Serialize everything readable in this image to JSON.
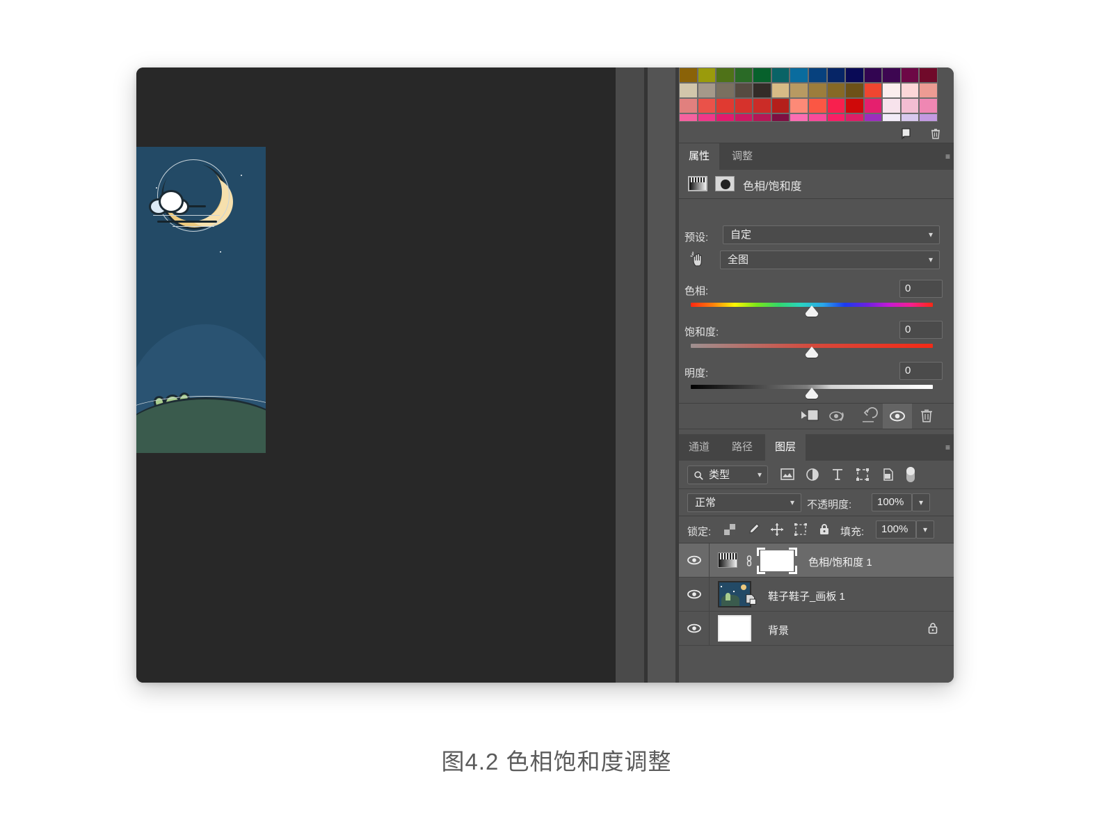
{
  "caption": "图4.2  色相饱和度调整",
  "swatches": {
    "rows": [
      [
        "#8a6208",
        "#9a9b0c",
        "#4f7218",
        "#2a6a26",
        "#07612c",
        "#0a6366",
        "#0a6c9e",
        "#07417e",
        "#062566",
        "#090a56",
        "#320551",
        "#3d0651",
        "#6d0846",
        "#700a2a"
      ],
      [
        "#d2c6ab",
        "#a5998a",
        "#7a7060",
        "#564b41",
        "#332c28",
        "#d7bb86",
        "#b89a62",
        "#9c7d3c",
        "#866926",
        "#6d5117",
        "#f04630",
        "#fbeeee",
        "#fcd6d8",
        "#ec9b93"
      ],
      [
        "#e1807e",
        "#ea5249",
        "#e03a31",
        "#d6322c",
        "#cb2c27",
        "#b41f1a",
        "#fd8a77",
        "#fb5744",
        "#f8204e",
        "#cf0909",
        "#e51f6e",
        "#f7e3ec",
        "#f3bdd2",
        "#ef87b3"
      ],
      [
        "#f5629f",
        "#f03889",
        "#e31a6d",
        "#cd1862",
        "#b51756",
        "#7d0f42",
        "#fb6eb2",
        "#f94b9a",
        "#f91f66",
        "#dd1f66",
        "#9b2fbd",
        "#f2ecf8",
        "#d8c9ee",
        "#c39ae2"
      ]
    ],
    "footer_icons": [
      "new-swatch-icon",
      "delete-swatch-icon"
    ]
  },
  "properties_panel": {
    "tabs": [
      {
        "label": "属性",
        "active": true
      },
      {
        "label": "调整",
        "active": false
      }
    ],
    "menu_glyph": "≡",
    "adjustment_title": "色相/饱和度",
    "preset_label": "预设:",
    "preset_value": "自定",
    "range_value": "全图",
    "sliders": [
      {
        "label": "色相:",
        "value": "0",
        "type": "hue",
        "thumb_pct": 50
      },
      {
        "label": "饱和度:",
        "value": "0",
        "type": "saturation",
        "thumb_pct": 50
      },
      {
        "label": "明度:",
        "value": "0",
        "type": "lightness",
        "thumb_pct": 50
      }
    ],
    "footer_icons": [
      "clip-to-layer-icon",
      "toggle-previous-state-icon",
      "reset-icon",
      "visibility-eye-icon",
      "delete-adjustment-icon"
    ]
  },
  "layers_panel": {
    "tabs": [
      {
        "label": "通道",
        "active": false
      },
      {
        "label": "路径",
        "active": false
      },
      {
        "label": "图层",
        "active": true
      }
    ],
    "menu_glyph": "≡",
    "filter_label": "类型",
    "filter_icons": [
      "pixel-layer-filter-icon",
      "adjustment-layer-filter-icon",
      "type-layer-filter-icon",
      "shape-layer-filter-icon",
      "smart-object-filter-icon",
      "filter-toggle-switch"
    ],
    "blend_mode": "正常",
    "opacity_label": "不透明度:",
    "opacity_value": "100%",
    "lock_label": "锁定:",
    "lock_icons": [
      "lock-transparent-pixels-icon",
      "lock-image-pixels-icon",
      "lock-position-icon",
      "lock-artboard-nesting-icon",
      "lock-all-icon"
    ],
    "fill_label": "填充:",
    "fill_value": "100%",
    "layers": [
      {
        "name": "色相/饱和度 1",
        "selected": true,
        "visible": true,
        "kind": "adjustment",
        "locked": false
      },
      {
        "name": "鞋子鞋子_画板 1",
        "selected": false,
        "visible": true,
        "kind": "artboard",
        "locked": false
      },
      {
        "name": "背景",
        "selected": false,
        "visible": true,
        "kind": "background",
        "locked": true
      }
    ]
  },
  "artwork": {
    "description": "夜景插画：月亮、云、仙人掌、草地",
    "sky_color": "#234a66",
    "moon_color": "#ecc97f",
    "ground_color": "#3a5b4d",
    "cactus_color": "#a9cd8e"
  }
}
